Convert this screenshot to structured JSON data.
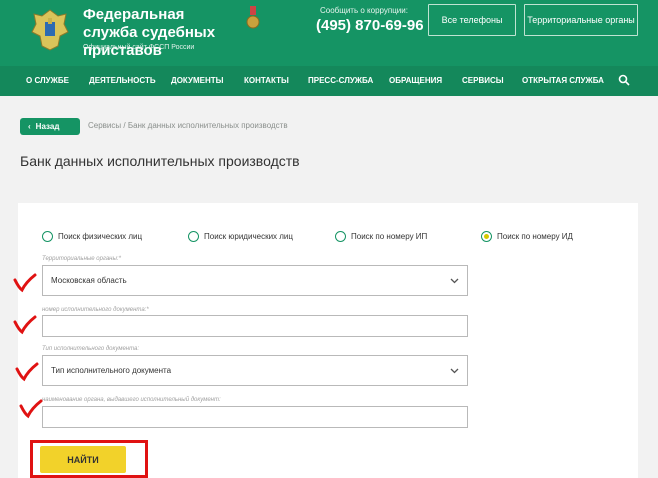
{
  "header": {
    "org_title": "Федеральная служба судебных приставов",
    "org_subtitle": "Официальный сайт ФССП России",
    "corruption_label": "Сообщить о коррупции:",
    "phone": "(495) 870-69-96",
    "all_phones_button": "Все телефоны",
    "territorial_button": "Территориальные органы"
  },
  "nav": {
    "items": [
      "О СЛУЖБЕ",
      "ДЕЯТЕЛЬНОСТЬ",
      "ДОКУМЕНТЫ",
      "КОНТАКТЫ",
      "ПРЕСС-СЛУЖБА",
      "ОБРАЩЕНИЯ",
      "СЕРВИСЫ",
      "ОТКРЫТАЯ СЛУЖБА"
    ],
    "search_icon": "search-icon"
  },
  "breadcrumb": {
    "back_label": "Назад",
    "path": "Сервисы / Банк данных исполнительных производств"
  },
  "page_title": "Банк данных исполнительных производств",
  "search_modes": [
    {
      "label": "Поиск физических лиц",
      "selected": false
    },
    {
      "label": "Поиск юридических лиц",
      "selected": false
    },
    {
      "label": "Поиск по номеру ИП",
      "selected": false
    },
    {
      "label": "Поиск по номеру ИД",
      "selected": true
    }
  ],
  "form": {
    "territorial_label": "Территориальные органы:*",
    "territorial_value": "Московская область",
    "doc_number_label": "номер исполнительного документа:*",
    "doc_number_value": "",
    "doc_type_label": "Тип исполнительного документа:",
    "doc_type_value": "Тип исполнительного документа",
    "issuer_label": "наименование органа, выдавшего исполнительный документ:",
    "issuer_value": "",
    "submit_label": "НАЙТИ"
  },
  "colors": {
    "brand_green": "#159464",
    "nav_green": "#14885b",
    "button_yellow": "#f2d22a",
    "annotation_red": "#e01212"
  }
}
